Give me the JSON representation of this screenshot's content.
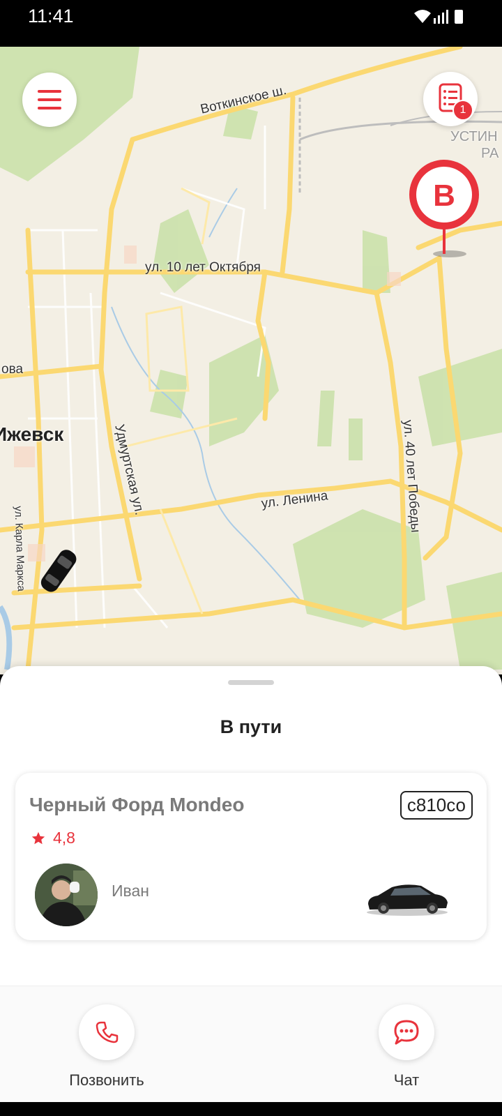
{
  "status_bar": {
    "time": "11:41"
  },
  "map": {
    "streets": {
      "votkinskoe": "Воткинское ш.",
      "oktyabrya": "ул. 10 лет Октября",
      "udmurtskaya": "Удмуртская ул.",
      "lenina": "ул. Ленина",
      "pobedy": "ул. 40 лет Победы",
      "karla_marksa": "ул. Карла Маркса",
      "ova": "ова",
      "ustin": "УСТИН",
      "ra": "РА"
    },
    "city": "Ижевск",
    "destination_marker": "B",
    "orders_badge": "1"
  },
  "sheet": {
    "title": "В пути",
    "car": {
      "name": "Черный Форд Mondeo",
      "plate": "с810со",
      "rating": "4,8",
      "driver": "Иван"
    }
  },
  "actions": {
    "call_label": "Позвонить",
    "chat_label": "Чат"
  },
  "colors": {
    "accent": "#e8333c",
    "road": "#fbd871",
    "park": "#c8e0a7"
  },
  "icons": [
    "menu-icon",
    "orders-icon",
    "star-icon",
    "phone-icon",
    "chat-icon"
  ]
}
